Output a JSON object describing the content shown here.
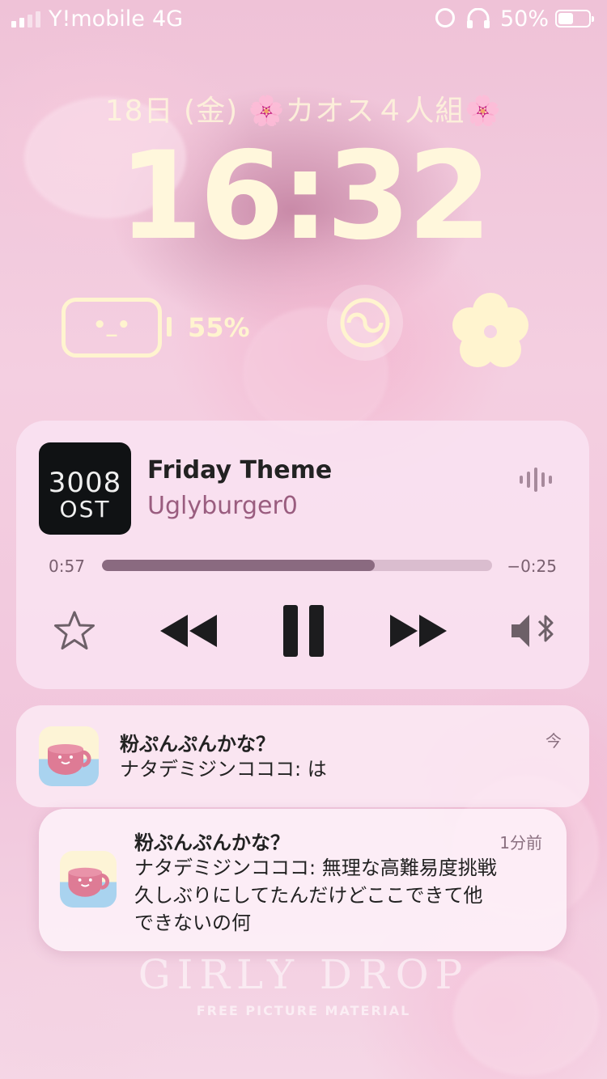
{
  "status_bar": {
    "carrier": "Y!mobile",
    "network": "4G",
    "battery_percent": "50%",
    "battery_level": 0.5
  },
  "lock": {
    "date": "18日 (金) 🌸カオス４人組🌸",
    "time": "16:32"
  },
  "widgets": {
    "battery_face": "•_•",
    "battery_pct": "55%"
  },
  "now_playing": {
    "album_art_line1": "3008",
    "album_art_line2": "OST",
    "title": "Friday Theme",
    "artist": "Uglyburger0",
    "elapsed": "0:57",
    "remaining": "−0:25",
    "progress": 0.7
  },
  "notifications": [
    {
      "title": "粉ぷんぷんかな？",
      "body": "ナタデミジンコココ: は",
      "time": "今"
    },
    {
      "title": "粉ぷんぷんかな？",
      "body_lines": [
        "ナタデミジンコココ: 無理な高難易度挑戦",
        "久しぶりにしてたんだけどここできて他",
        "できないの何"
      ],
      "time": "1分前"
    }
  ],
  "watermark": {
    "title": "GIRLY DROP",
    "subtitle": "FREE PICTURE MATERIAL"
  },
  "colors": {
    "clock": "#fff7dc",
    "artist": "#9a5d7f",
    "progress_fill": "#8a6a80"
  }
}
